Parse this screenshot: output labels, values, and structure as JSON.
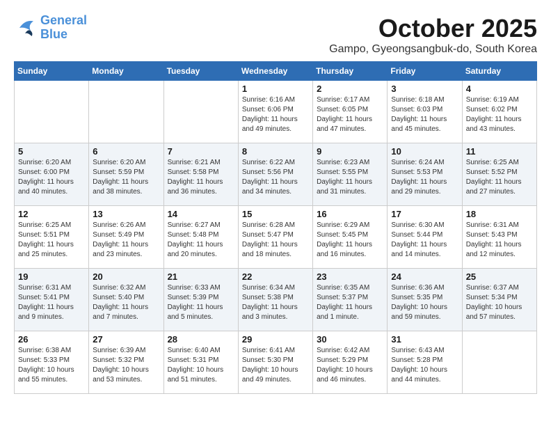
{
  "header": {
    "logo": {
      "line1": "General",
      "line2": "Blue"
    },
    "title": "October 2025",
    "location": "Gampo, Gyeongsangbuk-do, South Korea"
  },
  "weekdays": [
    "Sunday",
    "Monday",
    "Tuesday",
    "Wednesday",
    "Thursday",
    "Friday",
    "Saturday"
  ],
  "weeks": [
    [
      {
        "day": "",
        "info": ""
      },
      {
        "day": "",
        "info": ""
      },
      {
        "day": "",
        "info": ""
      },
      {
        "day": "1",
        "info": "Sunrise: 6:16 AM\nSunset: 6:06 PM\nDaylight: 11 hours\nand 49 minutes."
      },
      {
        "day": "2",
        "info": "Sunrise: 6:17 AM\nSunset: 6:05 PM\nDaylight: 11 hours\nand 47 minutes."
      },
      {
        "day": "3",
        "info": "Sunrise: 6:18 AM\nSunset: 6:03 PM\nDaylight: 11 hours\nand 45 minutes."
      },
      {
        "day": "4",
        "info": "Sunrise: 6:19 AM\nSunset: 6:02 PM\nDaylight: 11 hours\nand 43 minutes."
      }
    ],
    [
      {
        "day": "5",
        "info": "Sunrise: 6:20 AM\nSunset: 6:00 PM\nDaylight: 11 hours\nand 40 minutes."
      },
      {
        "day": "6",
        "info": "Sunrise: 6:20 AM\nSunset: 5:59 PM\nDaylight: 11 hours\nand 38 minutes."
      },
      {
        "day": "7",
        "info": "Sunrise: 6:21 AM\nSunset: 5:58 PM\nDaylight: 11 hours\nand 36 minutes."
      },
      {
        "day": "8",
        "info": "Sunrise: 6:22 AM\nSunset: 5:56 PM\nDaylight: 11 hours\nand 34 minutes."
      },
      {
        "day": "9",
        "info": "Sunrise: 6:23 AM\nSunset: 5:55 PM\nDaylight: 11 hours\nand 31 minutes."
      },
      {
        "day": "10",
        "info": "Sunrise: 6:24 AM\nSunset: 5:53 PM\nDaylight: 11 hours\nand 29 minutes."
      },
      {
        "day": "11",
        "info": "Sunrise: 6:25 AM\nSunset: 5:52 PM\nDaylight: 11 hours\nand 27 minutes."
      }
    ],
    [
      {
        "day": "12",
        "info": "Sunrise: 6:25 AM\nSunset: 5:51 PM\nDaylight: 11 hours\nand 25 minutes."
      },
      {
        "day": "13",
        "info": "Sunrise: 6:26 AM\nSunset: 5:49 PM\nDaylight: 11 hours\nand 23 minutes."
      },
      {
        "day": "14",
        "info": "Sunrise: 6:27 AM\nSunset: 5:48 PM\nDaylight: 11 hours\nand 20 minutes."
      },
      {
        "day": "15",
        "info": "Sunrise: 6:28 AM\nSunset: 5:47 PM\nDaylight: 11 hours\nand 18 minutes."
      },
      {
        "day": "16",
        "info": "Sunrise: 6:29 AM\nSunset: 5:45 PM\nDaylight: 11 hours\nand 16 minutes."
      },
      {
        "day": "17",
        "info": "Sunrise: 6:30 AM\nSunset: 5:44 PM\nDaylight: 11 hours\nand 14 minutes."
      },
      {
        "day": "18",
        "info": "Sunrise: 6:31 AM\nSunset: 5:43 PM\nDaylight: 11 hours\nand 12 minutes."
      }
    ],
    [
      {
        "day": "19",
        "info": "Sunrise: 6:31 AM\nSunset: 5:41 PM\nDaylight: 11 hours\nand 9 minutes."
      },
      {
        "day": "20",
        "info": "Sunrise: 6:32 AM\nSunset: 5:40 PM\nDaylight: 11 hours\nand 7 minutes."
      },
      {
        "day": "21",
        "info": "Sunrise: 6:33 AM\nSunset: 5:39 PM\nDaylight: 11 hours\nand 5 minutes."
      },
      {
        "day": "22",
        "info": "Sunrise: 6:34 AM\nSunset: 5:38 PM\nDaylight: 11 hours\nand 3 minutes."
      },
      {
        "day": "23",
        "info": "Sunrise: 6:35 AM\nSunset: 5:37 PM\nDaylight: 11 hours\nand 1 minute."
      },
      {
        "day": "24",
        "info": "Sunrise: 6:36 AM\nSunset: 5:35 PM\nDaylight: 10 hours\nand 59 minutes."
      },
      {
        "day": "25",
        "info": "Sunrise: 6:37 AM\nSunset: 5:34 PM\nDaylight: 10 hours\nand 57 minutes."
      }
    ],
    [
      {
        "day": "26",
        "info": "Sunrise: 6:38 AM\nSunset: 5:33 PM\nDaylight: 10 hours\nand 55 minutes."
      },
      {
        "day": "27",
        "info": "Sunrise: 6:39 AM\nSunset: 5:32 PM\nDaylight: 10 hours\nand 53 minutes."
      },
      {
        "day": "28",
        "info": "Sunrise: 6:40 AM\nSunset: 5:31 PM\nDaylight: 10 hours\nand 51 minutes."
      },
      {
        "day": "29",
        "info": "Sunrise: 6:41 AM\nSunset: 5:30 PM\nDaylight: 10 hours\nand 49 minutes."
      },
      {
        "day": "30",
        "info": "Sunrise: 6:42 AM\nSunset: 5:29 PM\nDaylight: 10 hours\nand 46 minutes."
      },
      {
        "day": "31",
        "info": "Sunrise: 6:43 AM\nSunset: 5:28 PM\nDaylight: 10 hours\nand 44 minutes."
      },
      {
        "day": "",
        "info": ""
      }
    ]
  ]
}
